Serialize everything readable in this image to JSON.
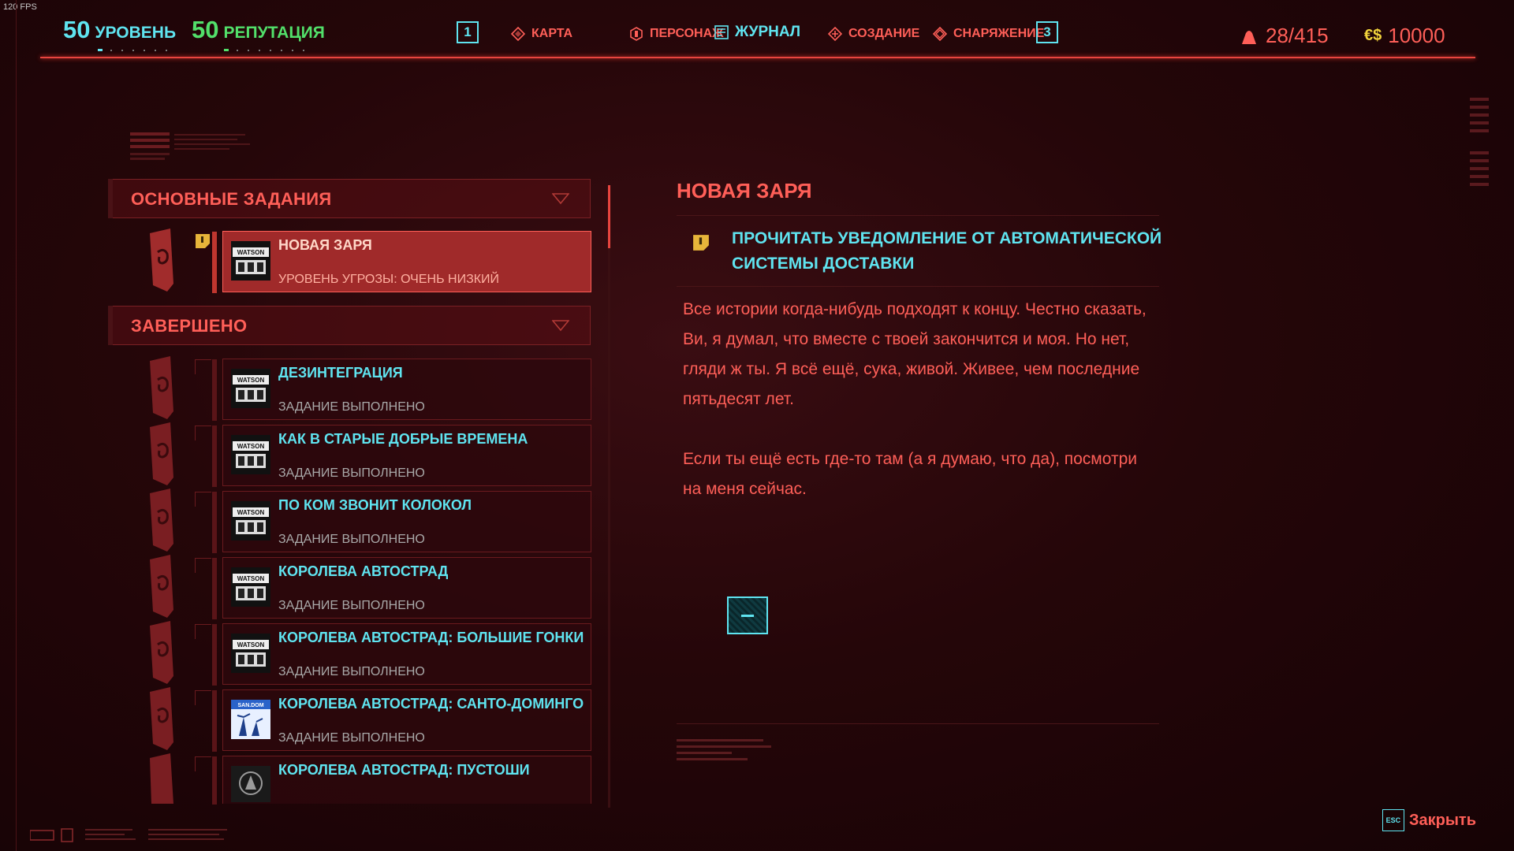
{
  "fps": "120 FPS",
  "top": {
    "level": {
      "value": "50",
      "label": "УРОВЕНЬ"
    },
    "reputation": {
      "value": "50",
      "label": "РЕПУТАЦИЯ"
    },
    "key_left": "1",
    "key_right": "3",
    "nav": [
      {
        "label": "КАРТА",
        "icon": "map-icon",
        "active": false
      },
      {
        "label": "ПЕРСОНАЖ",
        "icon": "character-icon",
        "active": false
      },
      {
        "label": "ЖУРНАЛ",
        "icon": "journal-icon",
        "active": true
      },
      {
        "label": "СОЗДАНИЕ",
        "icon": "crafting-icon",
        "active": false
      },
      {
        "label": "СНАРЯЖЕНИЕ",
        "icon": "inventory-icon",
        "active": false
      }
    ],
    "weight": "28/415",
    "money": "10000",
    "money_symbol": "€$"
  },
  "sections": {
    "main": "ОСНОВНЫЕ ЗАДАНИЯ",
    "done": "ЗАВЕРШЕНО"
  },
  "active_quest": {
    "name": "НОВАЯ ЗАРЯ",
    "status": "УРОВЕНЬ УГРОЗЫ: ОЧЕНЬ НИЗКИЙ",
    "thumb": "watson-icon"
  },
  "completed_quests": [
    {
      "name": "ДЕЗИНТЕГРАЦИЯ",
      "status": "ЗАДАНИЕ ВЫПОЛНЕНО",
      "thumb": "watson-icon"
    },
    {
      "name": "КАК В СТАРЫЕ ДОБРЫЕ ВРЕМЕНА",
      "status": "ЗАДАНИЕ ВЫПОЛНЕНО",
      "thumb": "watson-icon"
    },
    {
      "name": "ПО КОМ ЗВОНИТ КОЛОКОЛ",
      "status": "ЗАДАНИЕ ВЫПОЛНЕНО",
      "thumb": "watson-icon"
    },
    {
      "name": "КОРОЛЕВА АВТОСТРАД",
      "status": "ЗАДАНИЕ ВЫПОЛНЕНО",
      "thumb": "watson-icon"
    },
    {
      "name": "КОРОЛЕВА АВТОСТРАД: БОЛЬШИЕ ГОНКИ",
      "status": "ЗАДАНИЕ ВЫПОЛНЕНО",
      "thumb": "watson-icon"
    },
    {
      "name": "КОРОЛЕВА АВТОСТРАД: САНТО-ДОМИНГО",
      "status": "ЗАДАНИЕ ВЫПОЛНЕНО",
      "thumb": "santo-domingo-icon"
    },
    {
      "name": "КОРОЛЕВА АВТОСТРАД: ПУСТОШИ",
      "status": "",
      "thumb": "badlands-icon"
    }
  ],
  "detail": {
    "title": "НОВАЯ ЗАРЯ",
    "objective": "ПРОЧИТАТЬ УВЕДОМЛЕНИЕ ОТ АВТОМАТИЧЕСКОЙ СИСТЕМЫ ДОСТАВКИ",
    "text1": "Все истории когда-нибудь подходят к концу. Честно сказать, Ви, я думал, что вместе с твоей закончится и моя. Но нет, гляди ж ты. Я всё ещё, сука, живой. Живее, чем последние пятьдесят лет.",
    "text2": "Если ты ещё есть где-то там (а я думаю, что да), посмотри на меня сейчас."
  },
  "close": {
    "key": "ESC",
    "label": "Закрыть"
  },
  "colors": {
    "accent_red": "#ff5f58",
    "accent_cyan": "#5fe4f0",
    "active_bg": "#a02a2a",
    "money_yellow": "#f2d43c"
  }
}
